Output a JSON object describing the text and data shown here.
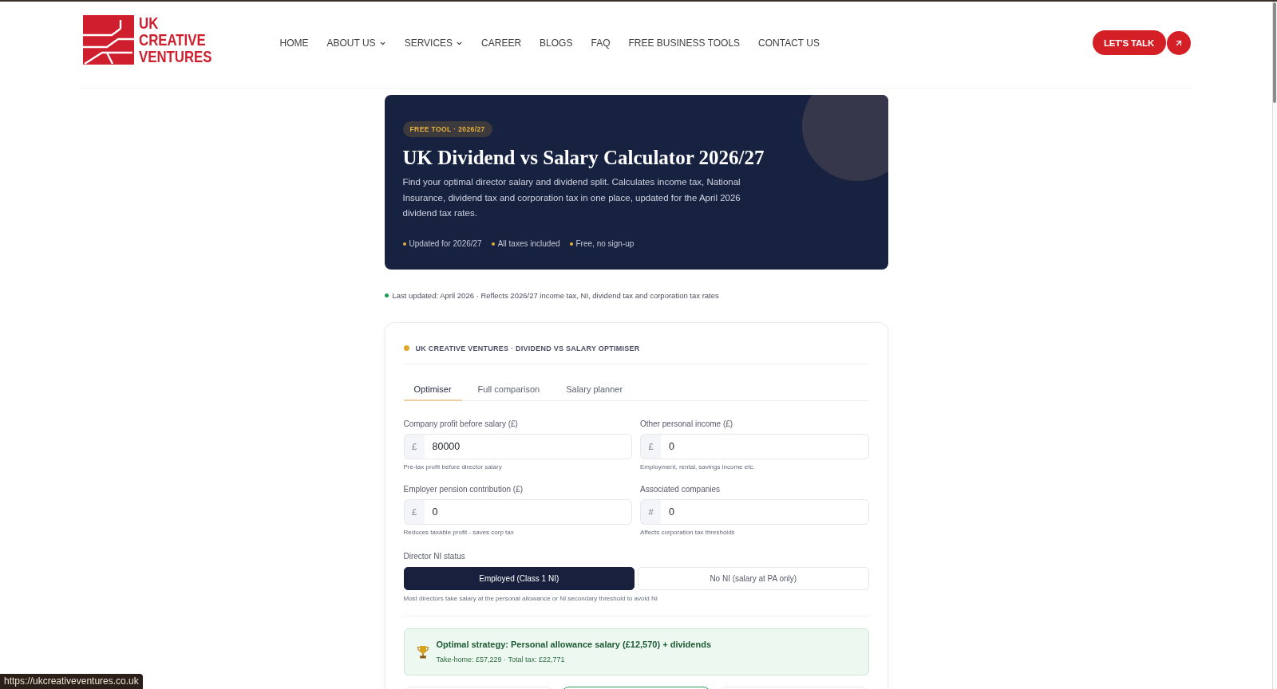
{
  "header": {
    "logo_text": "UK CREATIVE VENTURES",
    "nav": [
      {
        "label": "HOME",
        "has_menu": false
      },
      {
        "label": "ABOUT US",
        "has_menu": true
      },
      {
        "label": "SERVICES",
        "has_menu": true
      },
      {
        "label": "CAREER",
        "has_menu": false
      },
      {
        "label": "BLOGS",
        "has_menu": false
      },
      {
        "label": "FAQ",
        "has_menu": false
      },
      {
        "label": "FREE BUSINESS TOOLS",
        "has_menu": false
      },
      {
        "label": "CONTACT US",
        "has_menu": false
      }
    ],
    "cta": {
      "label": "LET'S TALK"
    }
  },
  "hero": {
    "badge": "FREE TOOL · 2026/27",
    "title": "UK Dividend vs Salary Calculator 2026/27",
    "description": "Find your optimal director salary and dividend split. Calculates income tax, National Insurance, dividend tax and corporation tax in one place, updated for the April 2026 dividend tax rates.",
    "features": [
      "Updated for 2026/27",
      "All taxes included",
      "Free, no sign-up"
    ]
  },
  "last_updated": "Last updated: April 2026 · Reflects 2026/27 income tax, NI, dividend tax and corporation tax rates",
  "calculator": {
    "heading": "UK CREATIVE VENTURES · DIVIDEND VS SALARY OPTIMISER",
    "tabs": [
      {
        "label": "Optimiser",
        "selected": true
      },
      {
        "label": "Full comparison",
        "selected": false
      },
      {
        "label": "Salary planner",
        "selected": false
      }
    ],
    "fields": [
      {
        "label": "Company profit before salary (£)",
        "prefix": "£",
        "value": "80000",
        "hint": "Pre-tax profit before director salary"
      },
      {
        "label": "Other personal income (£)",
        "prefix": "£",
        "value": "0",
        "hint": "Employment, rental, savings income etc."
      },
      {
        "label": "Employer pension contribution (£)",
        "prefix": "£",
        "value": "0",
        "hint": "Reduces taxable profit - saves corp tax"
      },
      {
        "label": "Associated companies",
        "prefix": "#",
        "value": "0",
        "hint": "Affects corporation tax thresholds"
      }
    ],
    "ni_status": {
      "label": "Director NI status",
      "options": [
        {
          "label": "Employed (Class 1 NI)",
          "selected": true
        },
        {
          "label": "No NI (salary at PA only)",
          "selected": false
        }
      ],
      "hint": "Most directors take salary at the personal allowance or NI secondary threshold to avoid NI"
    },
    "result": {
      "title": "Optimal strategy: Personal allowance salary (£12,570) + dividends",
      "summary": "Take-home: £57,229 · Total tax: £22,771"
    },
    "result_cards": [
      {
        "highlighted": false
      },
      {
        "highlighted": true
      },
      {
        "highlighted": false
      }
    ]
  },
  "status_url": "https://ukcreativeventures.co.uk"
}
